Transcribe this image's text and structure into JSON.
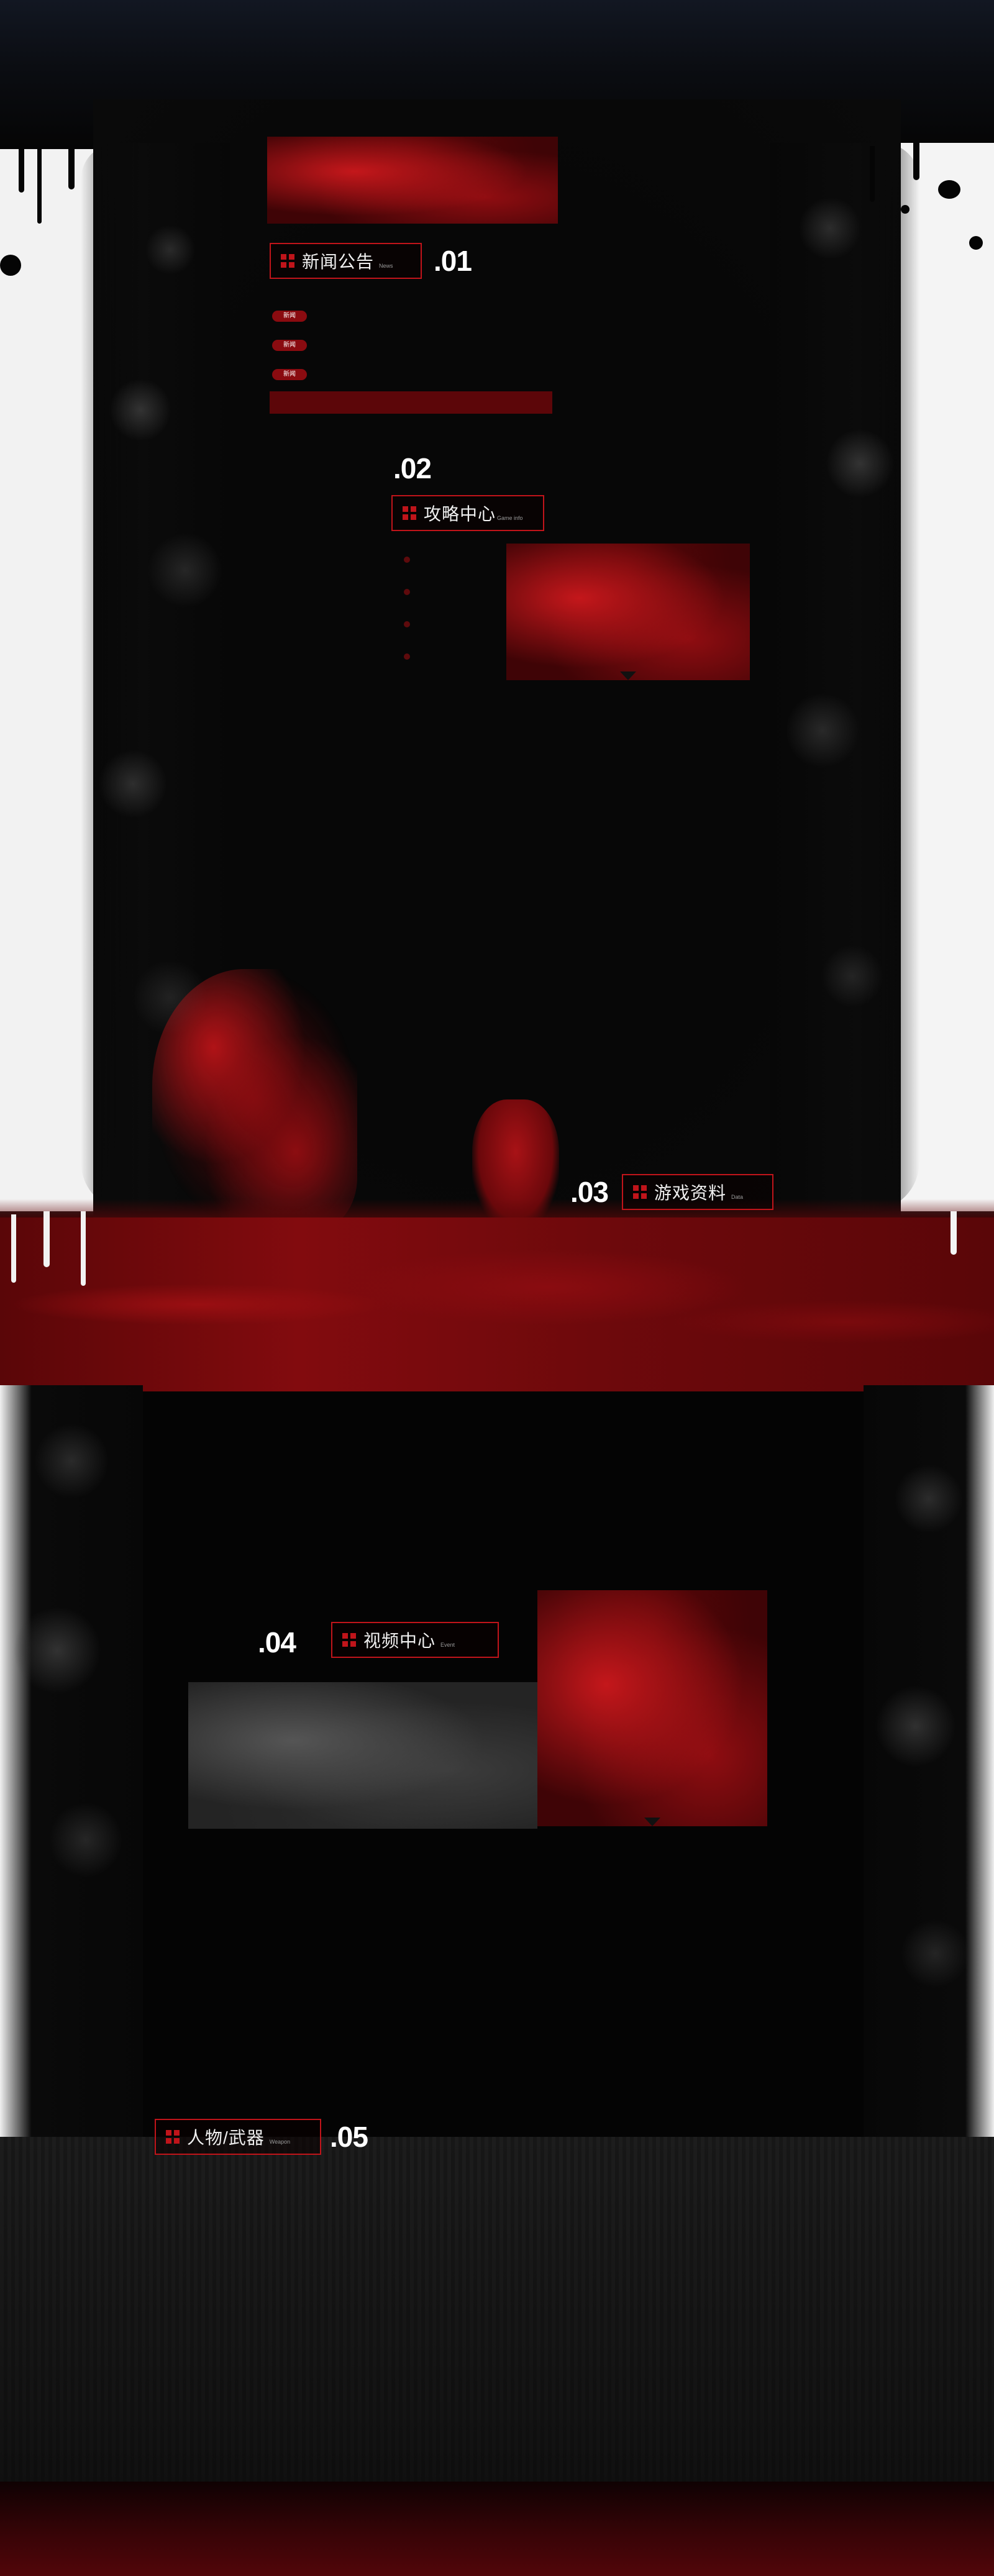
{
  "sections": {
    "news": {
      "title": "新闻公告",
      "subtitle": "News",
      "number": ".01",
      "items": [
        {
          "tag": "新闻"
        },
        {
          "tag": "新闻"
        },
        {
          "tag": "新闻"
        }
      ]
    },
    "guide": {
      "title": "攻略中心",
      "subtitle": "Game info",
      "number": ".02"
    },
    "data": {
      "title": "游戏资料",
      "subtitle": "Data",
      "number": ".03"
    },
    "video": {
      "title": "视频中心",
      "subtitle": "Event",
      "number": ".04"
    },
    "characters": {
      "title": "人物/武器",
      "subtitle": "Weapon",
      "number": ".05"
    }
  },
  "colors": {
    "accent": "#c0141a",
    "blood": "#8a0b10",
    "background": "#050505",
    "splash": "#f2f2f2"
  },
  "icons": {
    "section_icon": "grid-icon",
    "play": "play-triangle-icon"
  }
}
